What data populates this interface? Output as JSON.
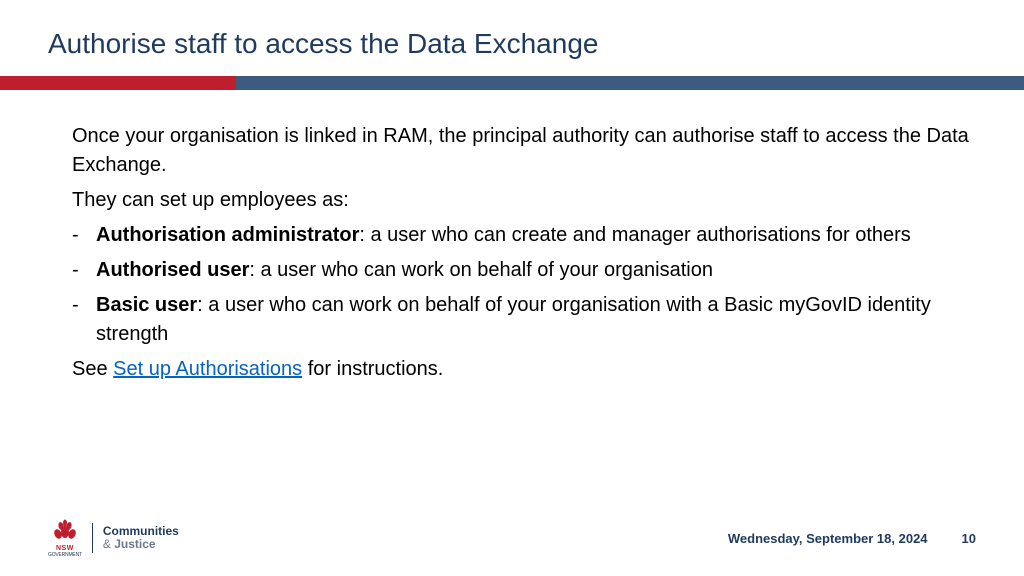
{
  "title": "Authorise staff to access the Data Exchange",
  "intro": "Once your organisation is linked in RAM, the principal authority can authorise staff to access the Data Exchange.",
  "setupLine": "They can set up employees as:",
  "items": [
    {
      "term": "Authorisation administrator",
      "desc": ": a user who can create and manager authorisations for others"
    },
    {
      "term": "Authorised user",
      "desc": ": a user who can work on behalf of your organisation"
    },
    {
      "term": "Basic user",
      "desc": ": a user who can work on behalf of your organisation with a Basic myGovID identity strength"
    }
  ],
  "seePrefix": "See ",
  "seeLink": "Set up Authorisations",
  "seeSuffix": " for instructions.",
  "footer": {
    "nsw": "NSW",
    "gov": "GOVERNMENT",
    "deptLine1": "Communities",
    "deptAmp": "& ",
    "deptLine2": "Justice",
    "date": "Wednesday, September 18, 2024",
    "page": "10"
  }
}
